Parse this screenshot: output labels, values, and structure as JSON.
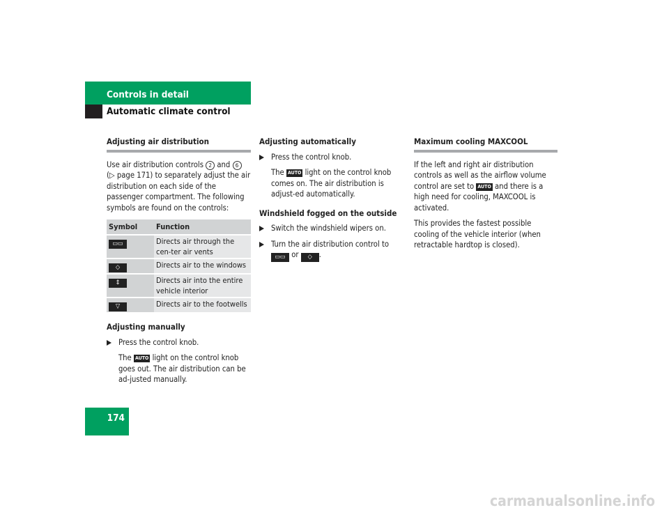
{
  "header": {
    "section": "Controls in detail",
    "subsection": "Automatic climate control",
    "page_number": "174"
  },
  "col1": {
    "heading": "Adjusting air distribution",
    "intro_a": "Use air distribution controls",
    "ctrl1": "2",
    "and": "and",
    "ctrl2": "6",
    "intro_b": "(▷ page 171) to separately adjust the air distribution on each side of the passenger compartment. The following symbols are found on the controls:",
    "table": {
      "headers": [
        "Symbol",
        "Function"
      ],
      "rows": [
        {
          "icon": "center-vents-icon",
          "glyph": "▭▭",
          "function": "Directs air through the cen-ter air vents"
        },
        {
          "icon": "windows-icon",
          "glyph": "◇",
          "function": "Directs air to the windows"
        },
        {
          "icon": "entire-interior-icon",
          "glyph": "⇕",
          "function": "Directs air into the entire vehicle interior"
        },
        {
          "icon": "footwells-icon",
          "glyph": "▽",
          "function": "Directs air to the footwells"
        }
      ]
    },
    "manual_heading": "Adjusting manually",
    "manual_step": "Press the control knob.",
    "manual_note_a": "The",
    "auto": "AUTO",
    "manual_note_b": "light on the control knob goes out. The air distribution can be ad-justed manually."
  },
  "col2": {
    "auto_heading": "Adjusting automatically",
    "auto_step": "Press the control knob.",
    "auto_note_a": "The",
    "auto_note_b": "light on the control knob comes on. The air distribution is adjust-ed automatically.",
    "fog_heading": "Windshield fogged on the outside",
    "fog_step1": "Switch the windshield wipers on.",
    "fog_step2_a": "Turn the air distribution control to",
    "fog_step2_or": "or",
    "fog_step2_end": "."
  },
  "col3": {
    "heading": "Maximum cooling MAXCOOL",
    "p1_a": "If the left and right air distribution controls as well as the airflow volume control are set to",
    "p1_b": "and there is a high need for cooling, MAXCOOL is activated.",
    "p2": "This provides the fastest possible cooling of the vehicle interior (when retractable hardtop is closed)."
  },
  "watermark": "carmanualsonline.info"
}
